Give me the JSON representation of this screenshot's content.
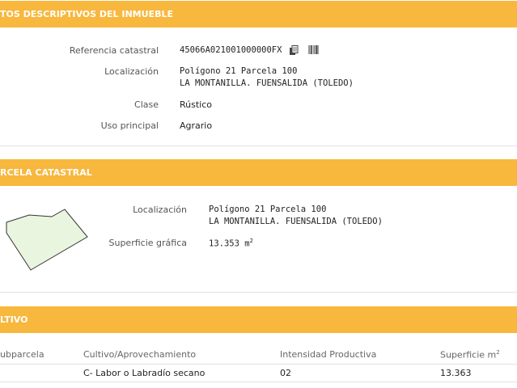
{
  "section1": {
    "title": "TOS DESCRIPTIVOS DEL INMUEBLE",
    "ref_label": "Referencia catastral",
    "ref_value": "45066A021001000000FX",
    "copy_icon": "copy-icon",
    "barcode_icon": "barcode-icon",
    "loc_label": "Localización",
    "loc_line1": "Polígono 21 Parcela 100",
    "loc_line2": "LA MONTANILLA. FUENSALIDA (TOLEDO)",
    "clase_label": "Clase",
    "clase_value": "Rústico",
    "uso_label": "Uso principal",
    "uso_value": "Agrario"
  },
  "section2": {
    "title": "RCELA CATASTRAL",
    "loc_label": "Localización",
    "loc_line1": "Polígono 21 Parcela 100",
    "loc_line2": "LA MONTANILLA. FUENSALIDA (TOLEDO)",
    "sup_label": "Superficie gráfica",
    "sup_value": "13.353 m",
    "sup_unit_exp": "2"
  },
  "section3": {
    "title": "LTIVO",
    "headers": [
      "ubparcela",
      "Cultivo/Aprovechamiento",
      "Intensidad Productiva",
      "Superficie m"
    ],
    "header_exp": "2",
    "row": [
      "",
      "C- Labor o Labradío secano",
      "02",
      "13.363"
    ]
  },
  "colors": {
    "header_bg": "#f8b73d",
    "parcel_fill": "#e9f5df"
  }
}
